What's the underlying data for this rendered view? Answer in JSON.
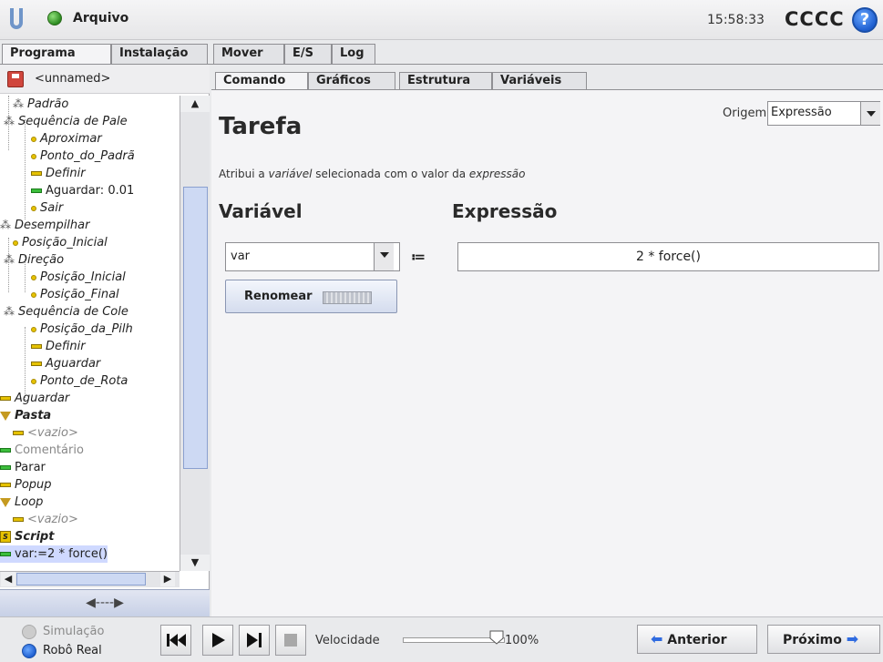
{
  "header": {
    "file_label": "Arquivo",
    "clock": "15:58:33",
    "robot_name": "CCCC",
    "help": "?"
  },
  "main_tabs": [
    "Programa",
    "Instalação",
    "Mover",
    "E/S",
    "Log"
  ],
  "program": {
    "name": "<unnamed>",
    "tree": [
      {
        "label": "Padrão",
        "icon": "pattern-icon"
      },
      {
        "label": "Sequência de Pale",
        "icon": "pattern-icon"
      },
      {
        "label": "Aproximar",
        "icon": "waypoint-icon"
      },
      {
        "label": "Ponto_do_Padrã",
        "icon": "waypoint-icon"
      },
      {
        "label": "Definir",
        "icon": "set-icon"
      },
      {
        "label": "Aguardar: 0.01",
        "icon": "wait-icon"
      },
      {
        "label": "Sair",
        "icon": "waypoint-icon"
      },
      {
        "label": "Desempilhar",
        "icon": "pattern-icon"
      },
      {
        "label": "Posição_Inicial",
        "icon": "waypoint-icon"
      },
      {
        "label": "Direção",
        "icon": "pattern-icon"
      },
      {
        "label": "Posição_Inicial",
        "icon": "waypoint-icon"
      },
      {
        "label": "Posição_Final",
        "icon": "waypoint-icon"
      },
      {
        "label": "Sequência de Cole",
        "icon": "pattern-icon"
      },
      {
        "label": "Posição_da_Pilh",
        "icon": "waypoint-icon"
      },
      {
        "label": "Definir",
        "icon": "set-icon"
      },
      {
        "label": "Aguardar",
        "icon": "wait-icon"
      },
      {
        "label": "Ponto_de_Rota",
        "icon": "waypoint-icon"
      },
      {
        "label": "Aguardar",
        "icon": "wait-icon"
      },
      {
        "label": "Pasta",
        "icon": "folder-icon"
      },
      {
        "label": "<vazio>",
        "icon": "empty-icon"
      },
      {
        "label": "Comentário",
        "icon": "comment-icon"
      },
      {
        "label": "Parar",
        "icon": "halt-icon"
      },
      {
        "label": "Popup",
        "icon": "popup-icon"
      },
      {
        "label": "Loop",
        "icon": "loop-icon"
      },
      {
        "label": "<vazio>",
        "icon": "empty-icon"
      },
      {
        "label": "Script",
        "icon": "script-icon"
      },
      {
        "label": "var:=2 * force()",
        "icon": "assignment-icon"
      }
    ],
    "collapse": "◀----▶"
  },
  "sub_tabs": [
    "Comando",
    "Gráficos",
    "Estrutura",
    "Variáveis"
  ],
  "command": {
    "title": "Tarefa",
    "origin_label": "Origem",
    "origin_value": "Expressão",
    "desc_1": "Atribui a ",
    "desc_var": "variável",
    "desc_2": " selecionada com o valor da ",
    "desc_expr": "expressão",
    "variable_heading": "Variável",
    "expression_heading": "Expressão",
    "variable_value": "var",
    "assign_op": "≔",
    "expression_value": "2 * force()",
    "rename_label": "Renomear"
  },
  "footer": {
    "simulation": "Simulação",
    "real_robot": "Robô Real",
    "speed_label": "Velocidade",
    "speed_value": "100%",
    "speed_fraction": 1.0,
    "prev": "Anterior",
    "next": "Próximo"
  }
}
